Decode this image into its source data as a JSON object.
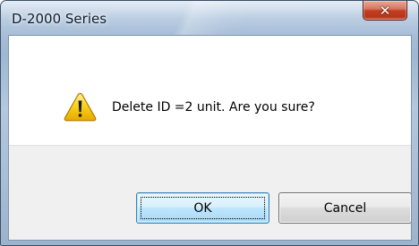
{
  "window": {
    "title": "D-2000 Series"
  },
  "message": {
    "text": "Delete ID =2  unit.  Are you sure?",
    "icon": "warning-icon"
  },
  "buttons": {
    "ok_label": "OK",
    "cancel_label": "Cancel",
    "close_icon": "close-icon"
  },
  "colors": {
    "close_button": "#c43d1f",
    "warning_yellow": "#f5c400",
    "default_button_border": "#3c7fb1"
  }
}
